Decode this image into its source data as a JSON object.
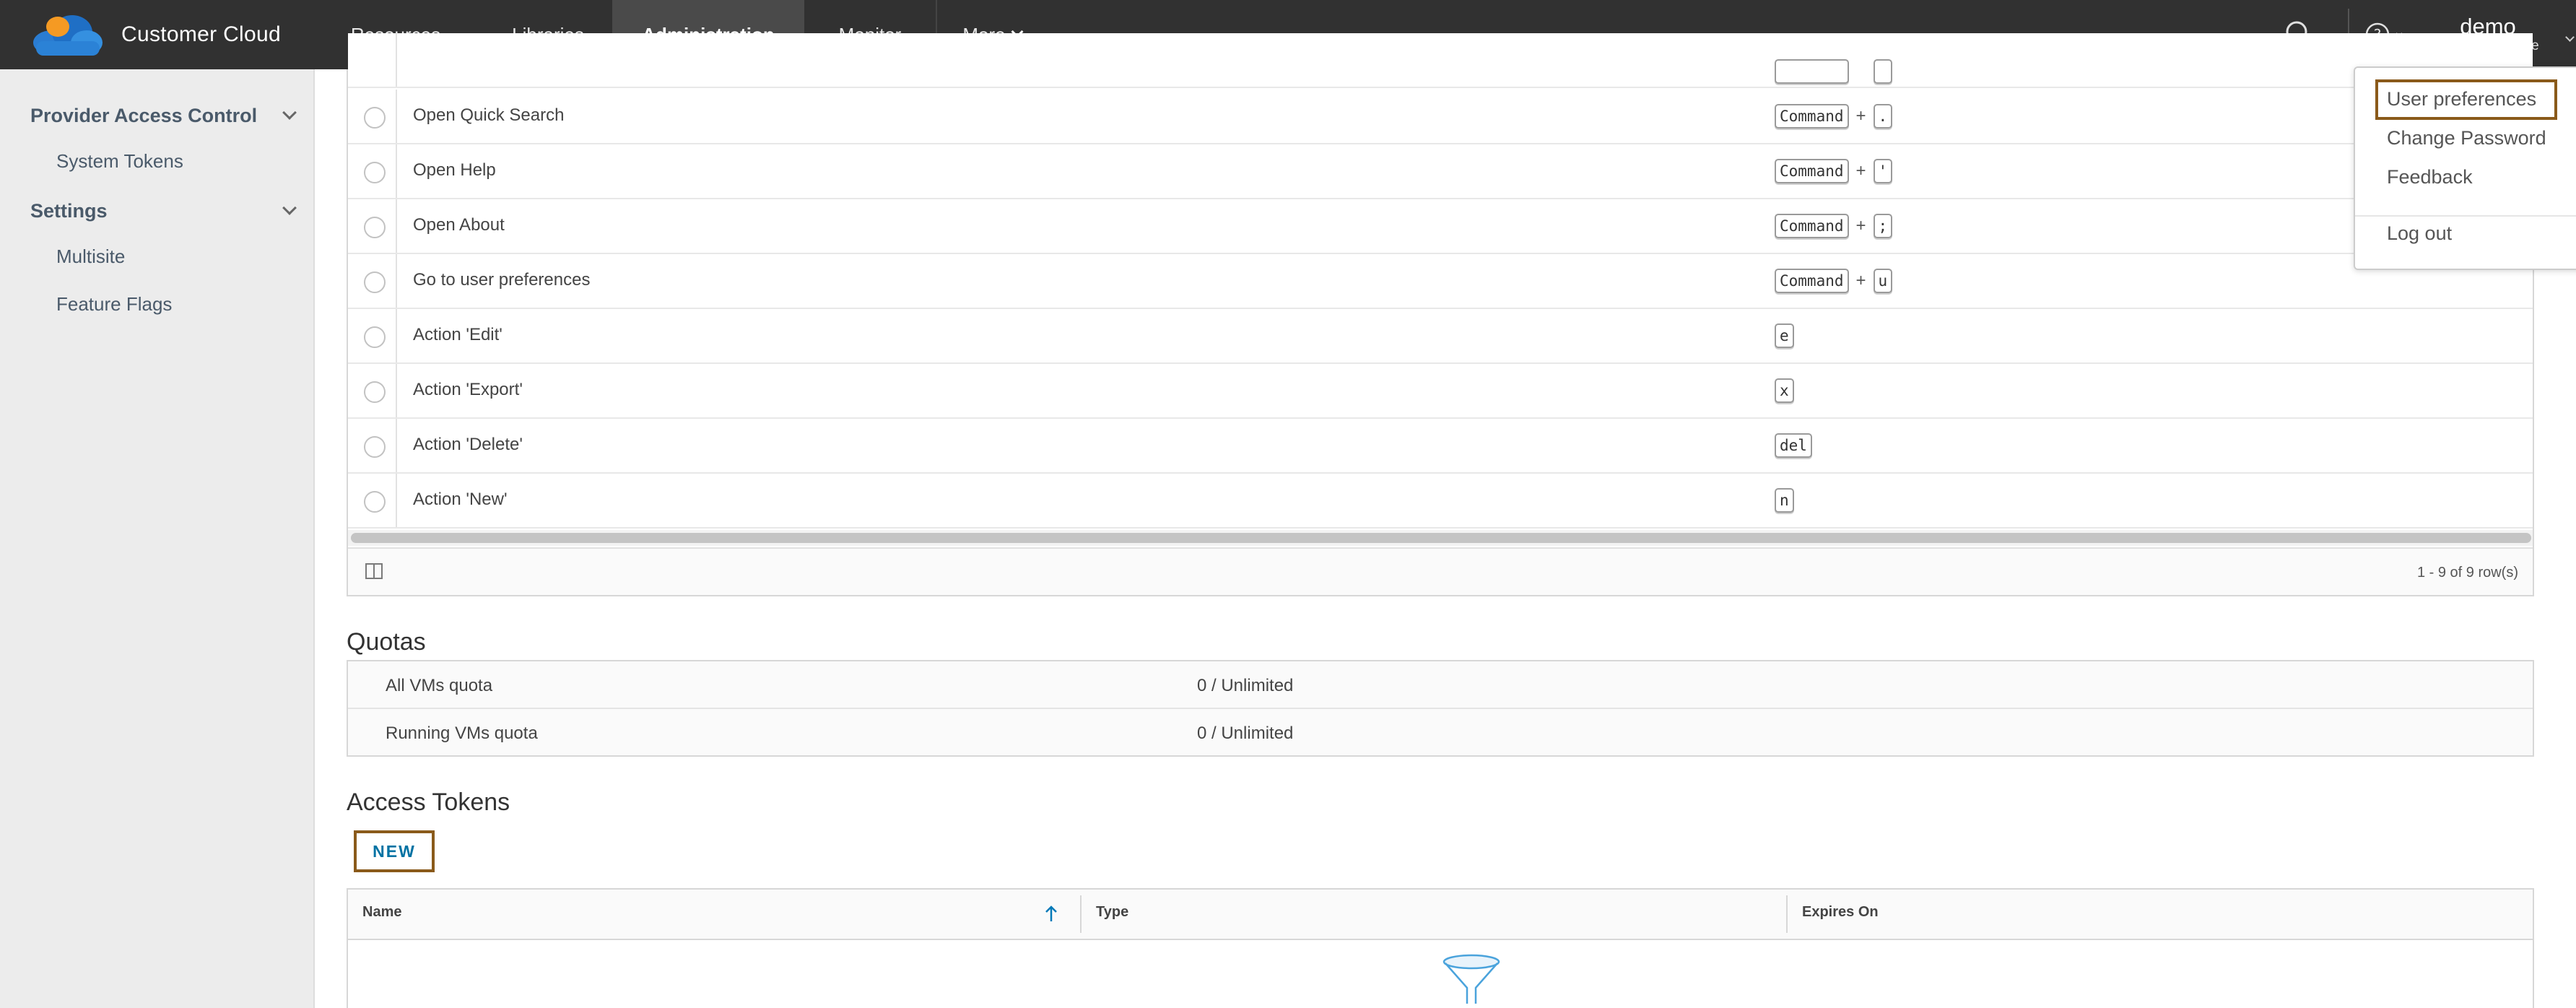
{
  "header": {
    "app_title": "Customer Cloud",
    "nav": [
      {
        "label": "Resources"
      },
      {
        "label": "Libraries"
      },
      {
        "label": "Administration",
        "active": true
      },
      {
        "label": "Monitor"
      },
      {
        "label": "More"
      }
    ],
    "user": {
      "name": "demo",
      "role": "CSE Admin Role"
    }
  },
  "sidebar": {
    "sections": [
      {
        "label": "Provider Access Control",
        "items": [
          {
            "label": "System Tokens"
          }
        ]
      },
      {
        "label": "Settings",
        "items": [
          {
            "label": "Multisite"
          },
          {
            "label": "Feature Flags"
          }
        ]
      }
    ]
  },
  "shortcuts": {
    "rows": [
      {
        "label": "Open Quick Search",
        "keys": [
          "Command",
          "."
        ]
      },
      {
        "label": "Open Help",
        "keys": [
          "Command",
          "'"
        ]
      },
      {
        "label": "Open About",
        "keys": [
          "Command",
          ";"
        ]
      },
      {
        "label": "Go to user preferences",
        "keys": [
          "Command",
          "u"
        ]
      },
      {
        "label": "Action 'Edit'",
        "keys": [
          "e"
        ]
      },
      {
        "label": "Action 'Export'",
        "keys": [
          "x"
        ]
      },
      {
        "label": "Action 'Delete'",
        "keys": [
          "del"
        ]
      },
      {
        "label": "Action 'New'",
        "keys": [
          "n"
        ]
      }
    ],
    "plus_sign": "+",
    "footer_count": "1 - 9 of 9 row(s)"
  },
  "quotas": {
    "title": "Quotas",
    "rows": [
      {
        "label": "All VMs quota",
        "value": "0 / Unlimited"
      },
      {
        "label": "Running VMs quota",
        "value": "0 / Unlimited"
      }
    ]
  },
  "access_tokens": {
    "title": "Access Tokens",
    "new_label": "NEW",
    "columns": [
      "Name",
      "Type",
      "Expires On"
    ]
  },
  "user_menu": {
    "items": [
      "User preferences",
      "Change Password",
      "Feedback",
      "Log out"
    ]
  },
  "colors": {
    "header_bg": "#313131",
    "highlight_border": "#8a5a1a",
    "link_blue": "#0072a3"
  }
}
